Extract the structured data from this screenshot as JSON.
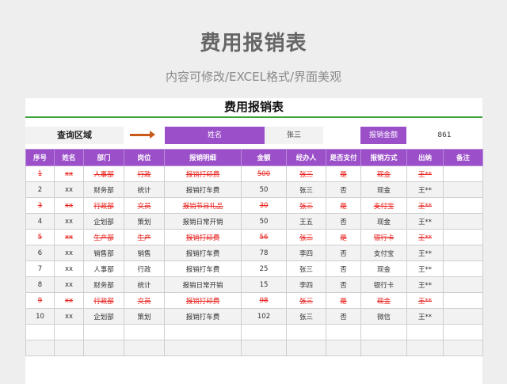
{
  "header": {
    "title": "费用报销表",
    "subtitle": "内容可修改/EXCEL格式/界面美观"
  },
  "sheet": {
    "title": "费用报销表",
    "query": {
      "label": "查询区域",
      "name_label": "姓名",
      "name_value": "张三",
      "amount_label": "报销金额",
      "amount_value": "861"
    },
    "columns": [
      "序号",
      "姓名",
      "部门",
      "岗位",
      "报销明细",
      "金额",
      "经办人",
      "是否支付",
      "报销方式",
      "出纳",
      "备注"
    ],
    "rows": [
      {
        "no": "1",
        "name": "xx",
        "dept": "人事部",
        "post": "行政",
        "detail": "报销打印费",
        "amount": "500",
        "handler": "张三",
        "paid": "是",
        "method": "现金",
        "cashier": "王**",
        "note": "",
        "highlight": true
      },
      {
        "no": "2",
        "name": "xx",
        "dept": "财务部",
        "post": "统计",
        "detail": "报销打车费",
        "amount": "50",
        "handler": "张三",
        "paid": "否",
        "method": "现金",
        "cashier": "王**",
        "note": "",
        "highlight": false
      },
      {
        "no": "3",
        "name": "xx",
        "dept": "行政部",
        "post": "文员",
        "detail": "报销节日礼品",
        "amount": "30",
        "handler": "张三",
        "paid": "是",
        "method": "支付宝",
        "cashier": "王**",
        "note": "",
        "highlight": true
      },
      {
        "no": "4",
        "name": "xx",
        "dept": "企划部",
        "post": "策划",
        "detail": "报销日常开销",
        "amount": "50",
        "handler": "王五",
        "paid": "否",
        "method": "现金",
        "cashier": "王**",
        "note": "",
        "highlight": false
      },
      {
        "no": "5",
        "name": "xx",
        "dept": "生产部",
        "post": "生产",
        "detail": "报销打印费",
        "amount": "56",
        "handler": "张三",
        "paid": "是",
        "method": "银行卡",
        "cashier": "王**",
        "note": "",
        "highlight": true
      },
      {
        "no": "6",
        "name": "xx",
        "dept": "销售部",
        "post": "销售",
        "detail": "报销打车费",
        "amount": "78",
        "handler": "李四",
        "paid": "否",
        "method": "支付宝",
        "cashier": "王**",
        "note": "",
        "highlight": false
      },
      {
        "no": "7",
        "name": "xx",
        "dept": "人事部",
        "post": "行政",
        "detail": "报销打车费",
        "amount": "25",
        "handler": "张三",
        "paid": "否",
        "method": "现金",
        "cashier": "王**",
        "note": "",
        "highlight": false
      },
      {
        "no": "8",
        "name": "xx",
        "dept": "财务部",
        "post": "统计",
        "detail": "报销日常开销",
        "amount": "15",
        "handler": "李四",
        "paid": "否",
        "method": "银行卡",
        "cashier": "王**",
        "note": "",
        "highlight": false
      },
      {
        "no": "9",
        "name": "xx",
        "dept": "行政部",
        "post": "文员",
        "detail": "报销打印费",
        "amount": "98",
        "handler": "张三",
        "paid": "是",
        "method": "现金",
        "cashier": "王**",
        "note": "",
        "highlight": true
      },
      {
        "no": "10",
        "name": "xx",
        "dept": "企划部",
        "post": "策划",
        "detail": "报销打车费",
        "amount": "102",
        "handler": "张三",
        "paid": "否",
        "method": "微信",
        "cashier": "王**",
        "note": "",
        "highlight": false
      }
    ],
    "empty_rows": 2
  },
  "colors": {
    "header_purple": "#9b4fc9",
    "highlight_red": "#e8231f",
    "rule_green": "#3aa13a",
    "arrow_orange": "#c85a1a"
  }
}
